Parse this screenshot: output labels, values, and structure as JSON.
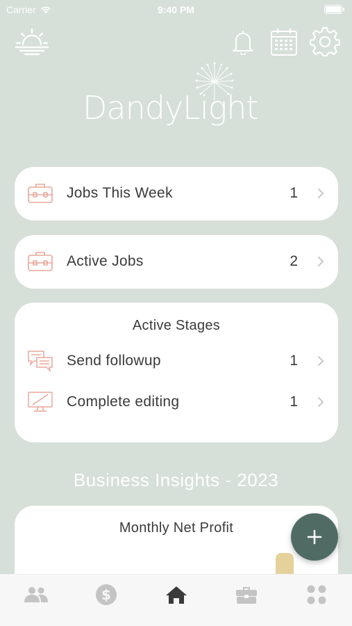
{
  "status_bar": {
    "carrier": "Carrier",
    "time": "9:40 PM"
  },
  "header": {
    "icons": [
      "sunrise-icon",
      "bell-icon",
      "calendar-icon",
      "gear-icon"
    ],
    "logo_text": "DandyLight"
  },
  "cards": {
    "jobs_this_week": {
      "label": "Jobs This Week",
      "count": "1"
    },
    "active_jobs": {
      "label": "Active Jobs",
      "count": "2"
    },
    "active_stages": {
      "title": "Active Stages",
      "items": [
        {
          "label": "Send followup",
          "count": "1"
        },
        {
          "label": "Complete editing",
          "count": "1"
        }
      ]
    }
  },
  "insights": {
    "title": "Business Insights - 2023",
    "profit_card_title": "Monthly Net Profit"
  },
  "fab": {
    "label": "+"
  },
  "tab_bar": {
    "items": [
      {
        "icon": "people-icon",
        "active": false
      },
      {
        "icon": "dollar-icon",
        "active": false
      },
      {
        "icon": "home-icon",
        "active": true
      },
      {
        "icon": "briefcase-icon",
        "active": false
      },
      {
        "icon": "grid-icon",
        "active": false
      }
    ]
  },
  "colors": {
    "background": "#d6dfd8",
    "accent_icon": "#e8a79a",
    "fab": "#4f6b64",
    "bar": "#e5d29a",
    "tab_active": "#3a3a3a",
    "tab_inactive": "#c4c4c4"
  }
}
